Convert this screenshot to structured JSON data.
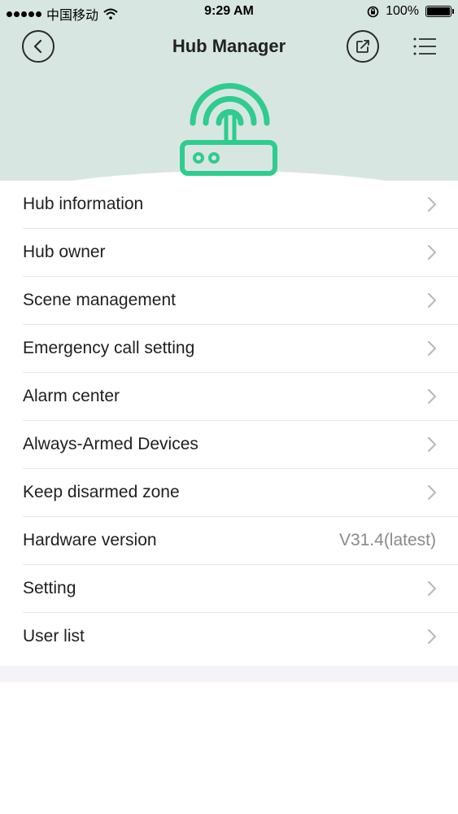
{
  "status_bar": {
    "carrier": "中国移动",
    "time": "9:29 AM",
    "battery_percent": "100%"
  },
  "header": {
    "title": "Hub Manager"
  },
  "menu": [
    {
      "label": "Hub information",
      "value": "",
      "chevron": true
    },
    {
      "label": "Hub owner",
      "value": "",
      "chevron": true
    },
    {
      "label": "Scene management",
      "value": "",
      "chevron": true
    },
    {
      "label": "Emergency call setting",
      "value": "",
      "chevron": true
    },
    {
      "label": "Alarm center",
      "value": "",
      "chevron": true
    },
    {
      "label": "Always-Armed Devices",
      "value": "",
      "chevron": true
    },
    {
      "label": "Keep disarmed zone",
      "value": "",
      "chevron": true
    },
    {
      "label": "Hardware version",
      "value": "V31.4(latest)",
      "chevron": false
    },
    {
      "label": "Setting",
      "value": "",
      "chevron": true
    },
    {
      "label": "User list",
      "value": "",
      "chevron": true
    }
  ],
  "colors": {
    "header_bg": "#d8e6e1",
    "accent_green": "#2ecc8f"
  },
  "icons": {
    "back": "chevron-left-icon",
    "share": "share-icon",
    "menu": "list-menu-icon",
    "hub": "hub-router-icon"
  }
}
